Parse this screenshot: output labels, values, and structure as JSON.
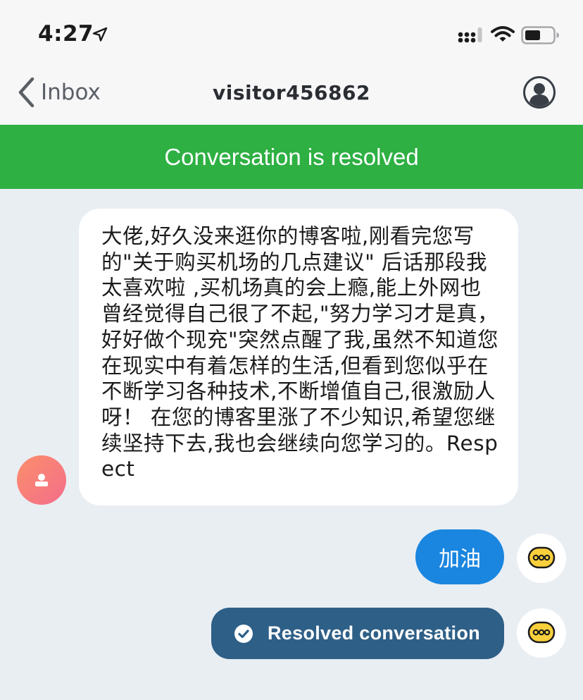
{
  "status_bar": {
    "time": "4:27",
    "icons": [
      "location-arrow-icon",
      "cellular-signal-icon",
      "wifi-icon",
      "battery-icon"
    ]
  },
  "nav": {
    "back_label": "Inbox",
    "title": "visitor456862",
    "profile_icon": "user-profile-icon"
  },
  "banner": {
    "text": "Conversation is resolved",
    "color": "#2eb043"
  },
  "messages": [
    {
      "direction": "incoming",
      "avatar_icon": "visitor-avatar-icon",
      "text": "大佬,好久没来逛你的博客啦,刚看完您写的\"关于购买机场的几点建议\"  后话那段我太喜欢啦 ,买机场真的会上瘾,能上外网也曾经觉得自己很了不起,\"努力学习才是真，好好做个现充\"突然点醒了我,虽然不知道您在现实中有着怎样的生活,但看到您似乎在不断学习各种技术,不断增值自己,很激励人呀！ 在您的博客里涨了不少知识,希望您继续坚持下去,我也会继续向您学习的。Respect"
    },
    {
      "direction": "outgoing",
      "avatar_icon": "agent-avatar-icon",
      "text": "加油",
      "color": "#1a86e0"
    }
  ],
  "system_event": {
    "icon": "check-circle-icon",
    "text": "Resolved conversation",
    "color": "#2e5f87"
  }
}
